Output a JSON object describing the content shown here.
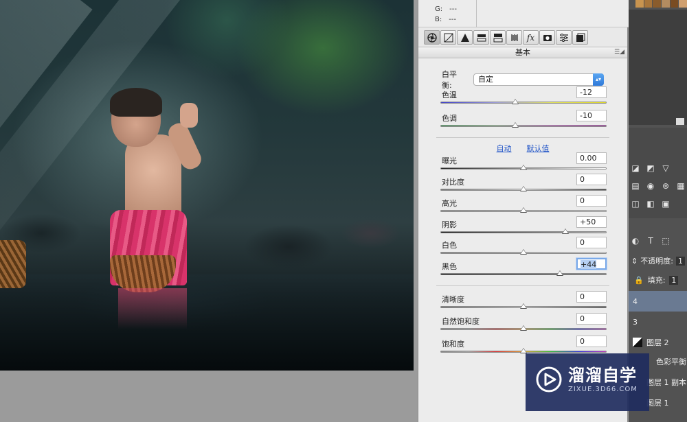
{
  "rgb_readout": {
    "g_label": "G:",
    "g_value": "---",
    "b_label": "B:",
    "b_value": "---"
  },
  "section": {
    "title": "基本"
  },
  "white_balance": {
    "label": "白平衡:",
    "value": "自定"
  },
  "sliders": {
    "temperature": {
      "label": "色温",
      "value": "-12",
      "level": 0.45
    },
    "tint": {
      "label": "色调",
      "value": "-10",
      "level": 0.45
    },
    "exposure": {
      "label": "曝光",
      "value": "0.00",
      "level": 0.5
    },
    "contrast": {
      "label": "对比度",
      "value": "0",
      "level": 0.5
    },
    "highlights": {
      "label": "高光",
      "value": "0",
      "level": 0.5
    },
    "shadows": {
      "label": "阴影",
      "value": "+50",
      "level": 0.75
    },
    "whites": {
      "label": "白色",
      "value": "0",
      "level": 0.5
    },
    "blacks": {
      "label": "黑色",
      "value": "+44",
      "level": 0.72
    },
    "clarity": {
      "label": "清晰度",
      "value": "0",
      "level": 0.5
    },
    "vibrance": {
      "label": "自然饱和度",
      "value": "0",
      "level": 0.5
    },
    "saturation": {
      "label": "饱和度",
      "value": "0",
      "level": 0.5
    }
  },
  "links": {
    "auto": "自动",
    "default": "默认值"
  },
  "layers": {
    "opacity_label": "不透明度:",
    "opacity_value": "1",
    "fill_label": "填充:",
    "fill_value": "1",
    "rows": [
      "4",
      "3",
      "图层 2",
      "色彩平衡",
      "图层 1 副本",
      "图层 1"
    ]
  },
  "watermark": {
    "name": "溜溜自学",
    "url": "ZIXUE.3D66.COM"
  },
  "colors": {
    "accent_blue": "#2f79d8",
    "selection": "#6a7a92",
    "watermark_bg": "#1f2d5e"
  }
}
